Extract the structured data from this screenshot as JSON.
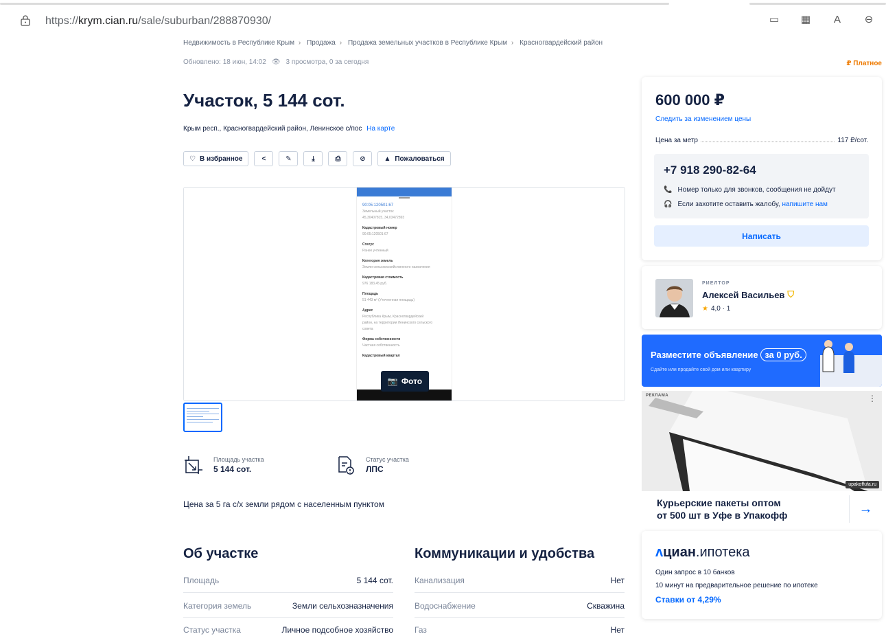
{
  "browser": {
    "url_prefix": "https://",
    "url_host": "krym.cian.ru",
    "url_path": "/sale/suburban/288870930/"
  },
  "breadcrumbs": [
    "Недвижимость в Республике Крым",
    "Продажа",
    "Продажа земельных участков в Республике Крым",
    "Красногвардейский район"
  ],
  "meta": {
    "updated": "Обновлено: 18 июн, 14:02",
    "views": "3 просмотра, 0 за сегодня",
    "paid": "₽ Платное"
  },
  "listing": {
    "title": "Участок, 5 144 сот.",
    "address": "Крым респ., Красногвардейский район, Ленинское с/пос",
    "map_link": "На карте"
  },
  "actions": {
    "favorite": "В избранное",
    "complain": "Пожаловаться"
  },
  "gallery": {
    "photo_button": "Фото",
    "phone_lines": [
      {
        "t": "90:05:120501:67",
        "c": "link"
      },
      {
        "t": "Земельный участок",
        "c": "g"
      },
      {
        "t": "45,30407815, 34,03472893",
        "c": "g"
      },
      {
        "t": "Кадастровый номер",
        "c": "h"
      },
      {
        "t": "90:05:120501:67",
        "c": "g"
      },
      {
        "t": "Статус",
        "c": "h"
      },
      {
        "t": "Ранее учтенный",
        "c": "g"
      },
      {
        "t": "Категория земель",
        "c": "h"
      },
      {
        "t": "Земли сельскохозяйственного назначения",
        "c": "g"
      },
      {
        "t": "Кадастровая стоимость",
        "c": "h"
      },
      {
        "t": "976 183,45 руб.",
        "c": "g"
      },
      {
        "t": "Площадь",
        "c": "h"
      },
      {
        "t": "51 443 м² (Уточненная площадь)",
        "c": "g"
      },
      {
        "t": "Адрес",
        "c": "h"
      },
      {
        "t": "Республика Крым, Красногвардейский",
        "c": "g"
      },
      {
        "t": "район, на территории Ленинского сельского",
        "c": "g"
      },
      {
        "t": "совета",
        "c": "g"
      },
      {
        "t": "Форма собственности",
        "c": "h"
      },
      {
        "t": "Частная собственность",
        "c": "g"
      },
      {
        "t": "Кадастровый квартал",
        "c": "h"
      }
    ]
  },
  "features": [
    {
      "label": "Площадь участка",
      "value": "5 144 сот."
    },
    {
      "label": "Статус участка",
      "value": "ЛПС"
    }
  ],
  "description": "Цена за 5 га с/х земли рядом с населенным пунктом",
  "about": {
    "title": "Об участке",
    "rows": [
      {
        "k": "Площадь",
        "v": "5 144 сот."
      },
      {
        "k": "Категория земель",
        "v": "Земли сельхозназначения"
      },
      {
        "k": "Статус участка",
        "v": "Личное подсобное хозяйство"
      }
    ]
  },
  "utilities": {
    "title": "Коммуникации и удобства",
    "rows": [
      {
        "k": "Канализация",
        "v": "Нет"
      },
      {
        "k": "Водоснабжение",
        "v": "Скважина"
      },
      {
        "k": "Газ",
        "v": "Нет"
      }
    ]
  },
  "price_card": {
    "price": "600 000 ₽",
    "follow": "Следить за изменением цены",
    "per_label": "Цена за метр",
    "per_value": "117 ₽/сот.",
    "phone": "+7 918 290-82-64",
    "note1": "Номер только для звонков, сообщения не дойдут",
    "note2_prefix": "Если захотите оставить жалобу,",
    "note2_link": "напишите нам",
    "write": "Написать"
  },
  "agent": {
    "role": "РИЕЛТОР",
    "name": "Алексей Васильев",
    "rating": "4,0 · 1"
  },
  "banner": {
    "title_prefix": "Разместите объявление",
    "title_badge": "за 0 руб.",
    "subtitle": "Сдайте или продайте свой дом или квартиру"
  },
  "ad": {
    "label": "РЕКЛАМА",
    "domain": "upakoffufa.ru",
    "title_line1": "Курьерские пакеты оптом",
    "title_line2": "от 500 шт в Уфе в Упакофф"
  },
  "mortgage": {
    "logo_bold": "циан",
    "logo_rest": ".ипотека",
    "line1": "Один запрос в 10 банков",
    "line2": "10 минут на предварительное решение по ипотеке",
    "rate": "Ставки от 4,29%"
  },
  "colors": {
    "accent": "#0468ff",
    "paid": "#ee7a00",
    "text": "#152242",
    "banner": "#1f6bff"
  }
}
